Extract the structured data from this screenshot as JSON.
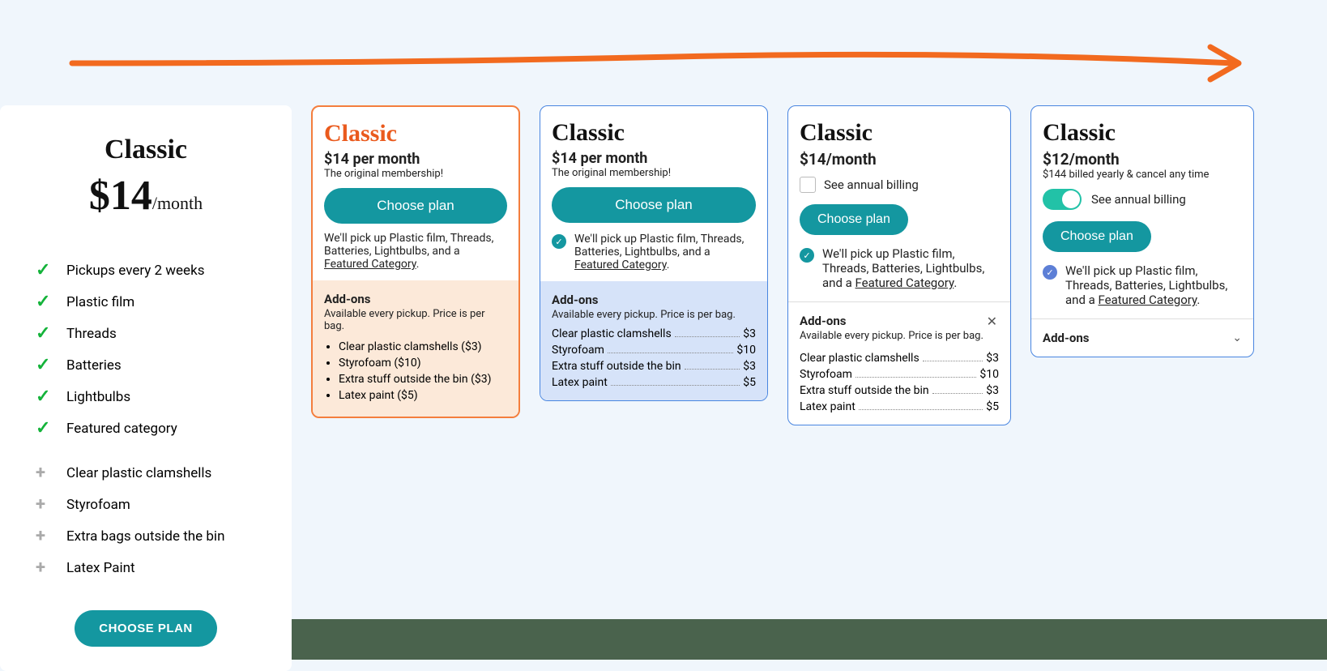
{
  "card1": {
    "title": "Classic",
    "price_big": "$14",
    "price_per": "/month",
    "features": [
      "Pickups every 2 weeks",
      "Plastic film",
      "Threads",
      "Batteries",
      "Lightbulbs",
      "Featured category"
    ],
    "addons": [
      "Clear plastic clamshells",
      "Styrofoam",
      "Extra bags outside the bin",
      "Latex Paint"
    ],
    "button": "CHOOSE PLAN"
  },
  "card2": {
    "title": "Classic",
    "price": "$14 per month",
    "tagline": "The original membership!",
    "button": "Choose plan",
    "desc_a": "We'll pick up Plastic film, Threads, Batteries, Lightbulbs, and a ",
    "desc_link": "Featured Category",
    "desc_c": ".",
    "addons_title": "Add-ons",
    "addons_sub": "Available every pickup. Price is per bag.",
    "addons": [
      "Clear plastic clamshells ($3)",
      "Styrofoam ($10)",
      "Extra stuff outside the bin ($3)",
      "Latex paint ($5)"
    ]
  },
  "card3": {
    "title": "Classic",
    "price": "$14 per month",
    "tagline": "The original membership!",
    "button": "Choose plan",
    "desc_a": "We'll pick up Plastic film, Threads, Batteries, Lightbulbs, and a ",
    "desc_link": "Featured Category",
    "desc_c": ".",
    "addons_title": "Add-ons",
    "addons_sub": "Available every pickup. Price is per bag.",
    "items": [
      {
        "label": "Clear plastic clamshells",
        "price": "$3"
      },
      {
        "label": "Styrofoam",
        "price": "$10"
      },
      {
        "label": "Extra stuff outside the bin",
        "price": "$3"
      },
      {
        "label": "Latex paint",
        "price": "$5"
      }
    ]
  },
  "card4": {
    "title": "Classic",
    "price": "$14/month",
    "toggle_label": "See annual billing",
    "button": "Choose plan",
    "desc_a": "We'll pick up Plastic film, Threads, Batteries, Lightbulbs, and a ",
    "desc_link": "Featured Category",
    "desc_c": ".",
    "addons_title": "Add-ons",
    "addons_sub": "Available every pickup. Price is per bag.",
    "items": [
      {
        "label": "Clear plastic clamshells",
        "price": "$3"
      },
      {
        "label": "Styrofoam",
        "price": "$10"
      },
      {
        "label": "Extra stuff outside the bin",
        "price": "$3"
      },
      {
        "label": "Latex paint",
        "price": "$5"
      }
    ]
  },
  "card5": {
    "title": "Classic",
    "price": "$12/month",
    "sub": "$144 billed yearly & cancel any time",
    "toggle_label": "See annual billing",
    "button": "Choose plan",
    "desc_a": "We'll pick up Plastic film, Threads, Batteries, Lightbulbs, and a ",
    "desc_link": "Featured Category",
    "desc_c": ".",
    "addons_title": "Add-ons"
  }
}
